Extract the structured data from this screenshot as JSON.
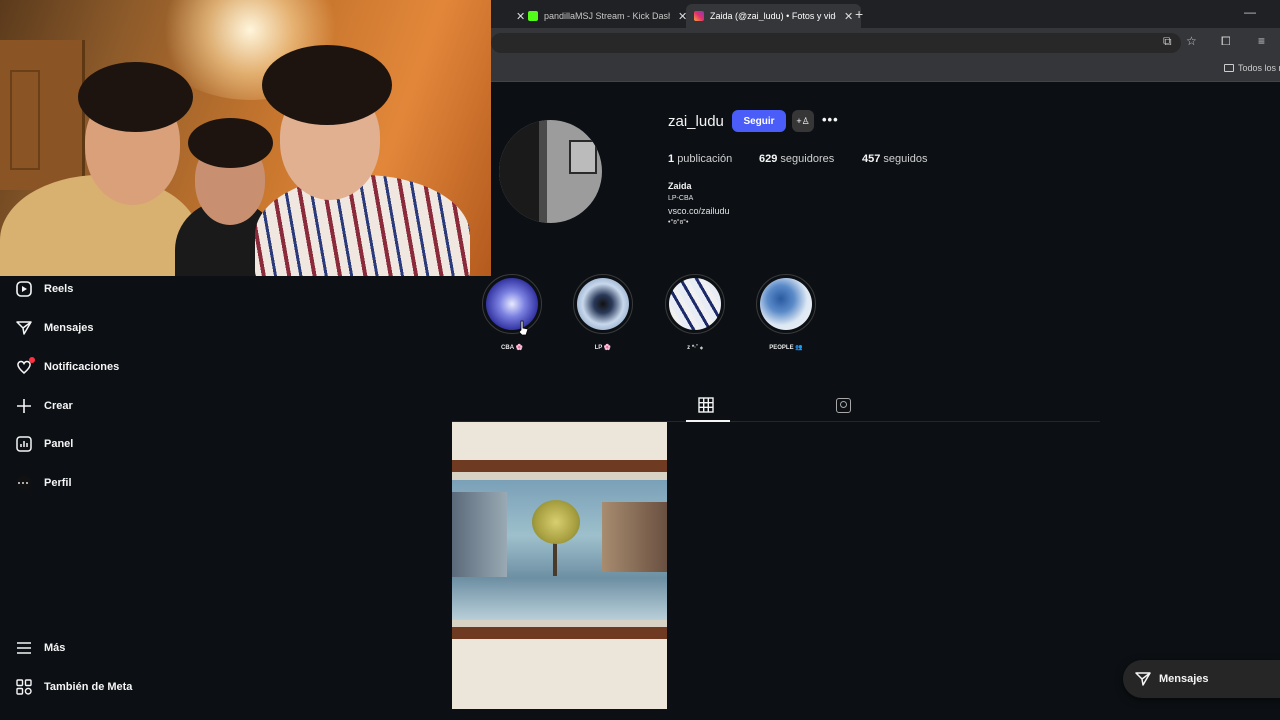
{
  "browser": {
    "tabs": [
      {
        "title": "pandillaMSJ Stream - Kick Dashboard",
        "favicon_color": "#53fc18",
        "active": false
      },
      {
        "title": "Zaida (@zai_ludu) • Fotos y videos de Instagram",
        "favicon_color": "#e1306c",
        "active": true
      }
    ],
    "new_tab_icon": "+",
    "bookmark_folder": "Todos los marcadores"
  },
  "nav": {
    "items": [
      {
        "label": "Reels",
        "icon": "reels-icon"
      },
      {
        "label": "Mensajes",
        "icon": "messenger-icon"
      },
      {
        "label": "Notificaciones",
        "icon": "heart-icon"
      },
      {
        "label": "Crear",
        "icon": "plus-icon"
      },
      {
        "label": "Panel",
        "icon": "dashboard-icon"
      },
      {
        "label": "Perfil",
        "icon": "profile-avatar-icon"
      },
      {
        "label": "Más",
        "icon": "menu-icon"
      },
      {
        "label": "También de Meta",
        "icon": "meta-icon"
      }
    ]
  },
  "profile": {
    "username": "zai_ludu",
    "follow_label": "Seguir",
    "stats": {
      "posts_count": "1",
      "posts_label": "publicación",
      "followers_count": "629",
      "followers_label": "seguidores",
      "following_count": "457",
      "following_label": "seguidos"
    },
    "bio": {
      "name": "Zaida",
      "line1": "LP-CBA",
      "link": "vsco.co/zailudu",
      "line2": "•°ʚ°ɞ°•"
    }
  },
  "highlights": [
    {
      "label": "CBA 🌸"
    },
    {
      "label": "LP 🌸"
    },
    {
      "label": "z *·˚ ⁎"
    },
    {
      "label": "PEOPLE 👥"
    }
  ],
  "floating": {
    "messages_label": "Mensajes"
  },
  "colors": {
    "accent": "#4a5df9",
    "background": "#0c1014",
    "notification_dot": "#ff3040"
  }
}
